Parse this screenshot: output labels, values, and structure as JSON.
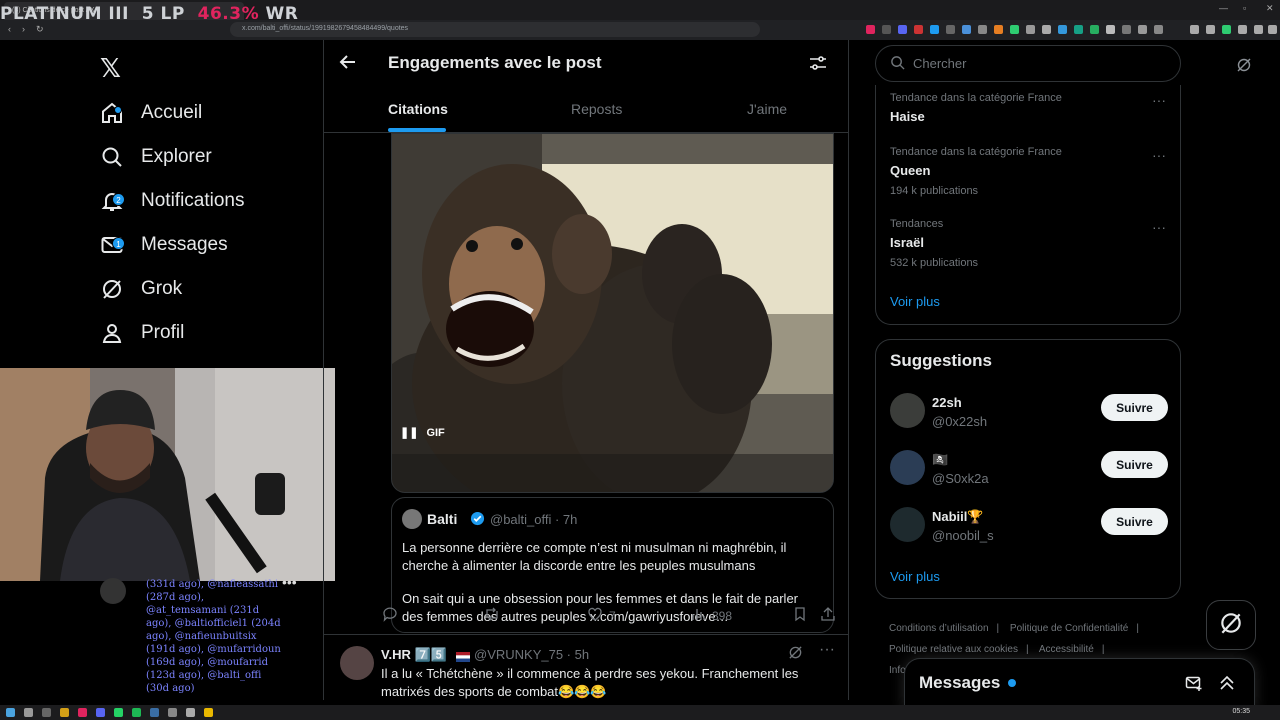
{
  "browser": {
    "tab_title": "(3) Citations de ce post / X",
    "url": "x.com/balti_offi/status/1991982679458484499/quotes"
  },
  "stream_overlay": {
    "rank": "PLATINUM III",
    "lp": "5 LP",
    "wr_value": "46.3%",
    "wr_label": "WR"
  },
  "nav": {
    "items": [
      {
        "label": "Accueil",
        "icon": "home-icon"
      },
      {
        "label": "Explorer",
        "icon": "search-icon"
      },
      {
        "label": "Notifications",
        "icon": "bell-icon",
        "badge": "2"
      },
      {
        "label": "Messages",
        "icon": "mail-icon",
        "badge": "1"
      },
      {
        "label": "Grok",
        "icon": "grok-icon"
      },
      {
        "label": "Profil",
        "icon": "user-icon"
      }
    ]
  },
  "autocomplete_text": "(331d ago), @nafieassathi (287d ago), @at_temsamani (231d ago), @baltiofficiel1 (204d ago), @nafieunbuitsix (191d ago), @mufarridoun (169d ago), @moufarrid (123d ago), @balti_offi (30d ago)",
  "main": {
    "title": "Engagements avec le post",
    "tabs": [
      "Citations",
      "Reposts",
      "J'aime"
    ],
    "gif_label": "GIF",
    "quoted": {
      "name": "Balti",
      "handle_time": "@balti_offi · 7h",
      "text_1": "La personne derrière ce compte n’est ni musulman ni maghrébin, il cherche à alimenter la discorde entre les peuples musulmans",
      "text_2": "On sait qui a une obsession pour les femmes et dans le fait de parler des femmes des autres peuples x.com/gawriyusforeve…"
    },
    "actions": {
      "likes": "7",
      "views": "398"
    },
    "reply": {
      "name": "V.HR 7️⃣5️⃣",
      "handle_time": "@VRUNKY_75 · 5h",
      "text": "Il a lu « Tchétchène » il commence à perdre ses yekou. Franchement les matrixés des sports de combat😂😂😂"
    }
  },
  "right": {
    "search_placeholder": "Chercher",
    "trends": [
      {
        "context": "Tendance dans la catégorie France",
        "name": "Haise",
        "count": ""
      },
      {
        "context": "Tendance dans la catégorie France",
        "name": "Queen",
        "count": "194 k publications"
      },
      {
        "context": "Tendances",
        "name": "Israël",
        "count": "532 k publications"
      }
    ],
    "trends_more": "Voir plus",
    "suggestions_title": "Suggestions",
    "suggestions": [
      {
        "name": "22sh",
        "handle": "@0x22sh",
        "button": "Suivre",
        "avatar_color": "#3b3d3a"
      },
      {
        "name": "🏴‍☠️",
        "handle": "@S0xk2a",
        "button": "Suivre",
        "avatar_color": "#2b3d55"
      },
      {
        "name": "Nabiil🏆",
        "handle": "@noobil_s",
        "button": "Suivre",
        "avatar_color": "#1e2a2e"
      }
    ],
    "suggestions_more": "Voir plus",
    "footer": [
      "Conditions d’utilisation",
      "|",
      "Politique de Confidentialité",
      "|",
      "Politique relative aux cookies",
      "|",
      "Accessibilité",
      "|",
      "Info"
    ],
    "messages_title": "Messages"
  },
  "taskbar": {
    "clock": "05:35"
  },
  "colors": {
    "accent": "#1d9bf0",
    "background": "#000000",
    "border": "#2f3336",
    "muted": "#71767b"
  }
}
